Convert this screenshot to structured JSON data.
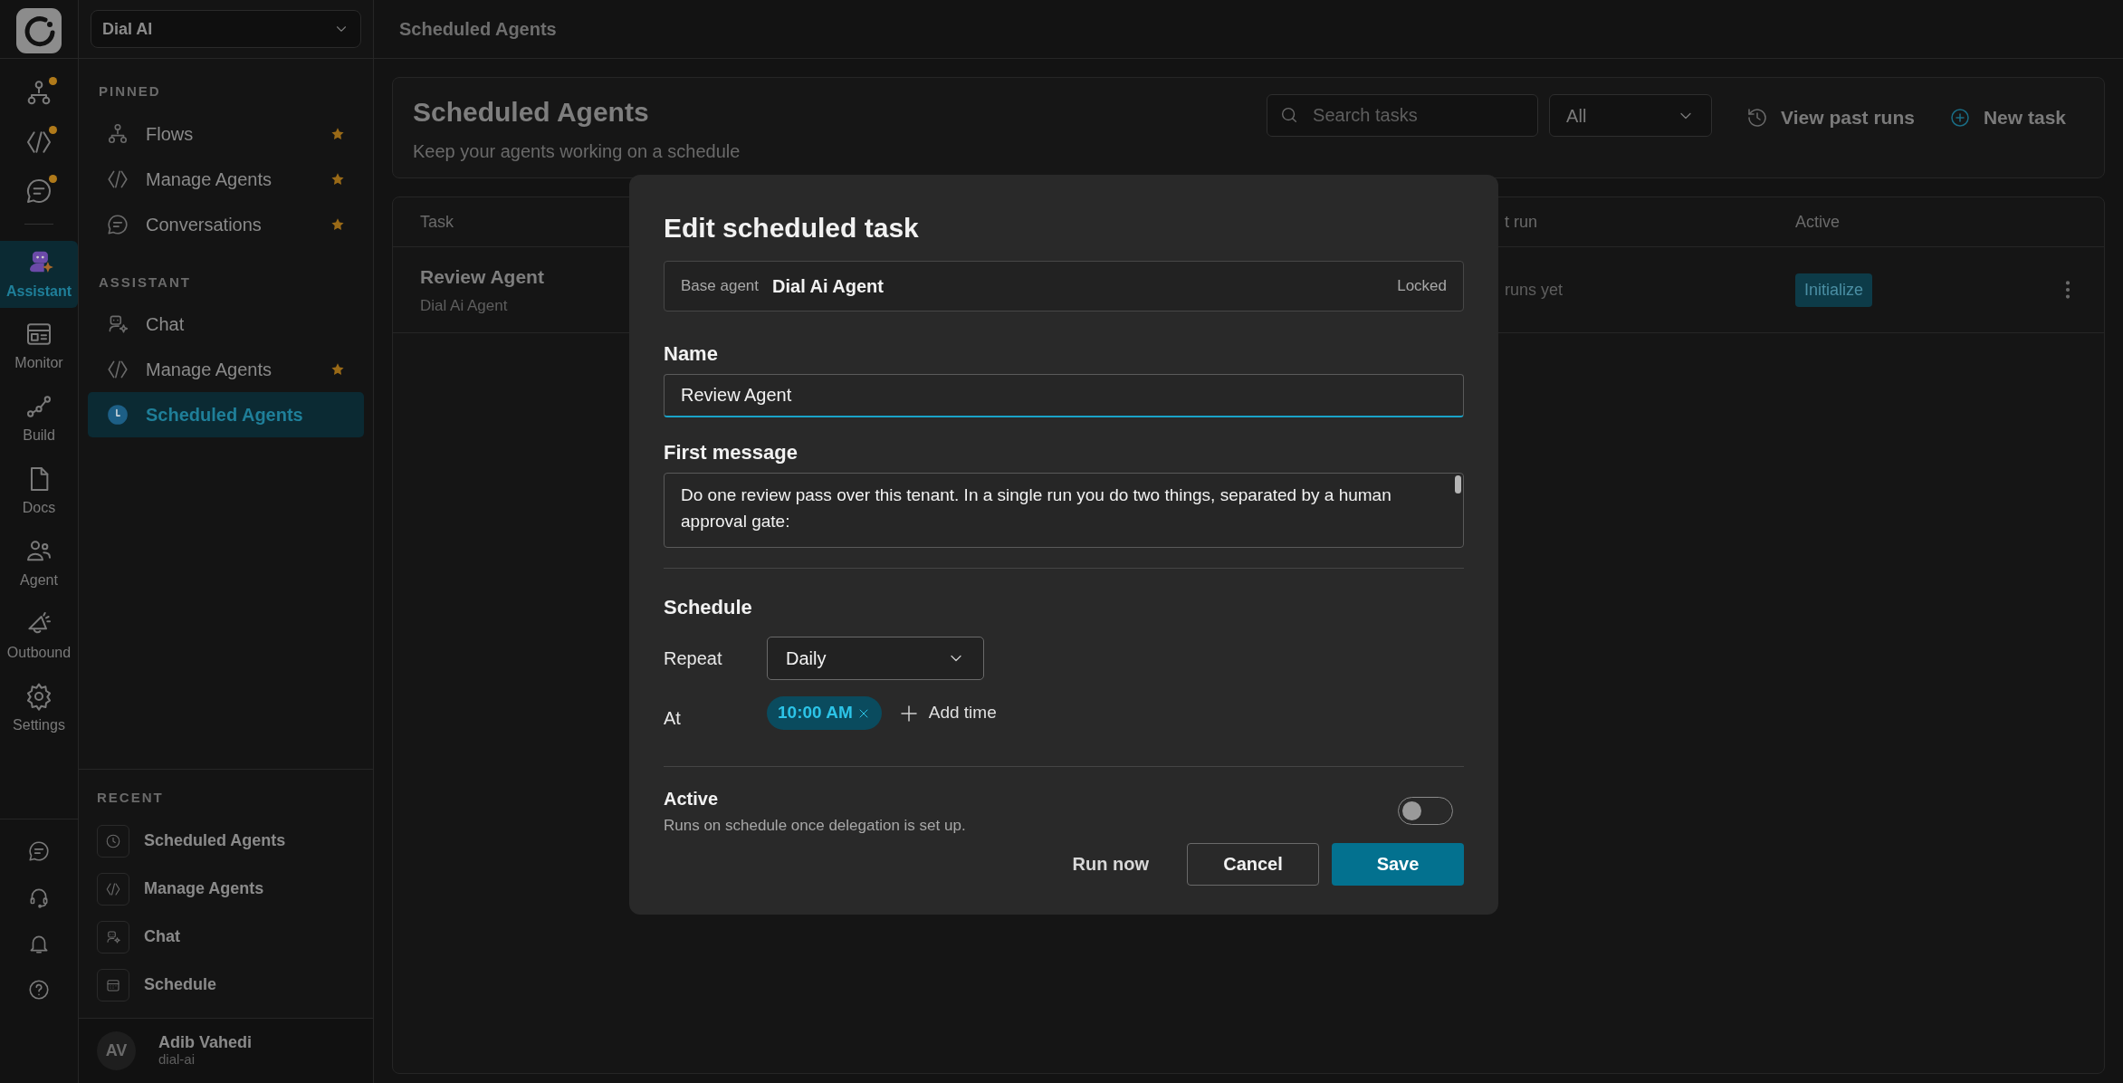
{
  "rail": {
    "top_items": [
      {
        "notified": true
      },
      {
        "notified": true
      },
      {
        "notified": true
      }
    ],
    "nav": [
      {
        "label": "Assistant",
        "selected": true
      },
      {
        "label": "Monitor",
        "selected": false
      },
      {
        "label": "Build",
        "selected": false
      },
      {
        "label": "Docs",
        "selected": false
      },
      {
        "label": "Agent",
        "selected": false
      },
      {
        "label": "Outbound",
        "selected": false
      },
      {
        "label": "Settings",
        "selected": false
      }
    ]
  },
  "sidebar": {
    "workspace": "Dial AI",
    "sections": [
      {
        "title": "PINNED",
        "items": [
          {
            "label": "Flows",
            "starred": true,
            "selected": false
          },
          {
            "label": "Manage Agents",
            "starred": true,
            "selected": false
          },
          {
            "label": "Conversations",
            "starred": true,
            "selected": false
          }
        ]
      },
      {
        "title": "ASSISTANT",
        "items": [
          {
            "label": "Chat",
            "starred": false,
            "selected": false
          },
          {
            "label": "Manage Agents",
            "starred": true,
            "selected": false
          },
          {
            "label": "Scheduled Agents",
            "starred": false,
            "selected": true
          }
        ]
      }
    ],
    "recent": {
      "title": "RECENT",
      "items": [
        "Scheduled Agents",
        "Manage Agents",
        "Chat",
        "Schedule"
      ]
    },
    "user": {
      "initials": "AV",
      "name": "Adib Vahedi",
      "handle": "dial-ai"
    }
  },
  "top_bar": {
    "title": "Scheduled Agents"
  },
  "header": {
    "title": "Scheduled Agents",
    "subtitle": "Keep your agents working on a schedule",
    "search": {
      "placeholder": "Search tasks"
    },
    "filter": "All",
    "buttons": [
      "View past runs",
      "New task"
    ]
  },
  "table": {
    "columns": [
      "Task",
      "t run",
      "Active"
    ],
    "rows": [
      {
        "task": "Review Agent",
        "agent": "Dial Ai Agent",
        "column_2": "runs yet",
        "status": "Initialize"
      }
    ]
  },
  "modal": {
    "title": "Edit scheduled task",
    "base_agent": {
      "label": "Base agent",
      "value": "Dial Ai Agent",
      "status": "Locked"
    },
    "name": {
      "label": "Name",
      "value": "Review Agent"
    },
    "first_message": {
      "label": "First message",
      "value": "Do one review pass over this tenant. In a single run you do two things, separated by a human approval gate:"
    },
    "schedule": {
      "title": "Schedule",
      "repeat_label": "Repeat",
      "repeat_value": "Daily",
      "at_label": "At",
      "times": [
        "10:00 AM"
      ],
      "add_time": "Add time"
    },
    "active": {
      "label": "Active",
      "description": "Runs on schedule once delegation is set up.",
      "on": false
    },
    "buttons": {
      "run_now": "Run now",
      "cancel": "Cancel",
      "save": "Save"
    }
  }
}
